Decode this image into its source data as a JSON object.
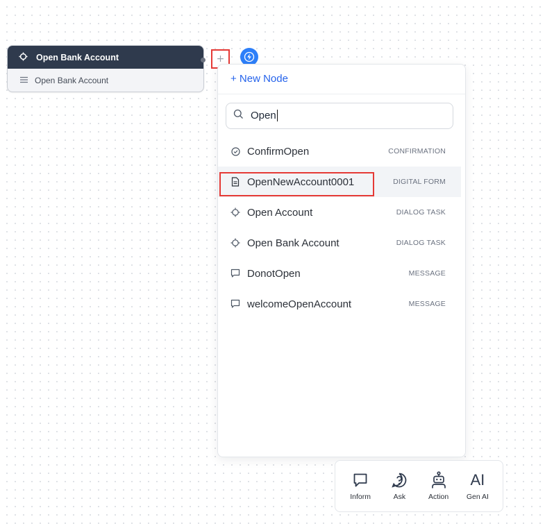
{
  "node": {
    "title": "Open Bank Account",
    "subtitle": "Open Bank Account"
  },
  "canvas": {
    "add_button_label": "+"
  },
  "panel": {
    "new_node_label": "+ New Node",
    "search": {
      "value": "Open",
      "placeholder": ""
    },
    "results": [
      {
        "name": "ConfirmOpen",
        "type": "CONFIRMATION",
        "icon": "check-circle-icon"
      },
      {
        "name": "OpenNewAccount0001",
        "type": "DIGITAL FORM",
        "icon": "document-icon"
      },
      {
        "name": "Open Account",
        "type": "DIALOG TASK",
        "icon": "crosshair-icon"
      },
      {
        "name": "Open Bank Account",
        "type": "DIALOG TASK",
        "icon": "crosshair-icon"
      },
      {
        "name": "DonotOpen",
        "type": "MESSAGE",
        "icon": "message-icon"
      },
      {
        "name": "welcomeOpenAccount",
        "type": "MESSAGE",
        "icon": "message-icon"
      }
    ]
  },
  "toolbar": {
    "inform_label": "Inform",
    "ask_label": "Ask",
    "action_label": "Action",
    "genai_label": "Gen AI",
    "genai_icon_text": "AI"
  },
  "colors": {
    "accent": "#2563eb",
    "node_header": "#2f3a4d",
    "highlight_border": "#e53935",
    "bolt": "#2d7ff9"
  }
}
